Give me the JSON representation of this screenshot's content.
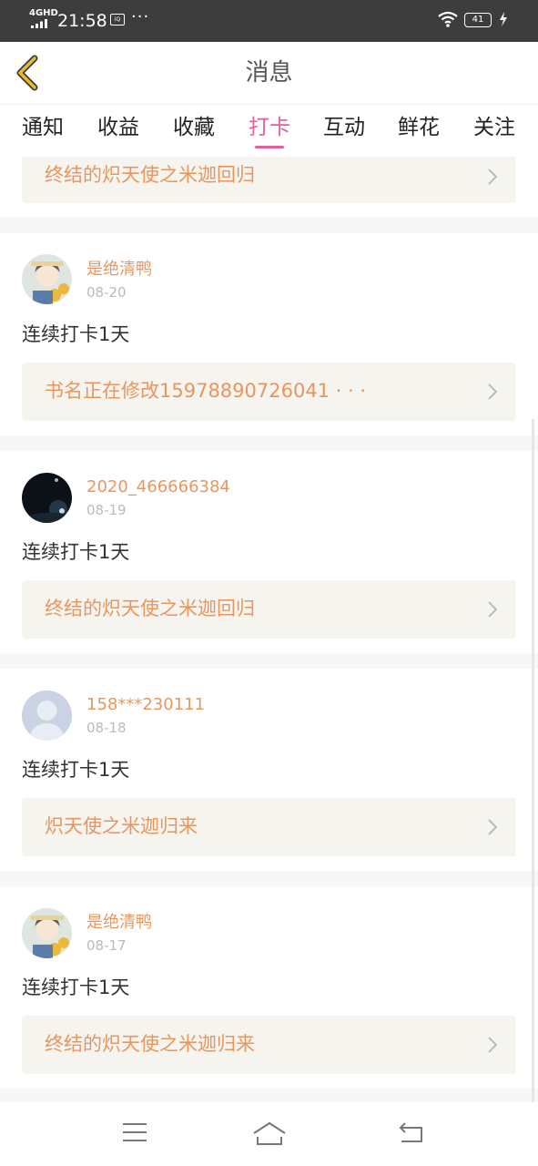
{
  "status": {
    "network": "4GHD",
    "time": "21:58",
    "app_badge": "iQIYI",
    "more": "···",
    "battery": "41"
  },
  "header": {
    "title": "消息"
  },
  "tabs": [
    {
      "label": "通知"
    },
    {
      "label": "收益"
    },
    {
      "label": "收藏"
    },
    {
      "label": "打卡",
      "active": true
    },
    {
      "label": "互动"
    },
    {
      "label": "鲜花"
    },
    {
      "label": "关注"
    }
  ],
  "partial_top": {
    "book_title": "终结的炽天使之米迦回归"
  },
  "items": [
    {
      "user": "是绝清鸭",
      "date": "08-20",
      "text": "连续打卡1天",
      "book_title": "书名正在修改15978890726041 · · ·",
      "avatar": "anime-boy"
    },
    {
      "user": "2020_466666384",
      "date": "08-19",
      "text": "连续打卡1天",
      "book_title": "终结的炽天使之米迦回归",
      "avatar": "night-sky"
    },
    {
      "user": "158***230111",
      "date": "08-18",
      "text": "连续打卡1天",
      "book_title": "炽天使之米迦归来",
      "avatar": "default-user"
    },
    {
      "user": "是绝清鸭",
      "date": "08-17",
      "text": "连续打卡1天",
      "book_title": "终结的炽天使之米迦归来",
      "avatar": "anime-boy"
    }
  ],
  "colors": {
    "accent": "#e85d9b",
    "username": "#e89660",
    "book_bg": "#f5f4ee",
    "back_icon": "#e8b92c"
  },
  "bottom_nav": [
    "menu-icon",
    "home-icon",
    "back-nav-icon"
  ]
}
